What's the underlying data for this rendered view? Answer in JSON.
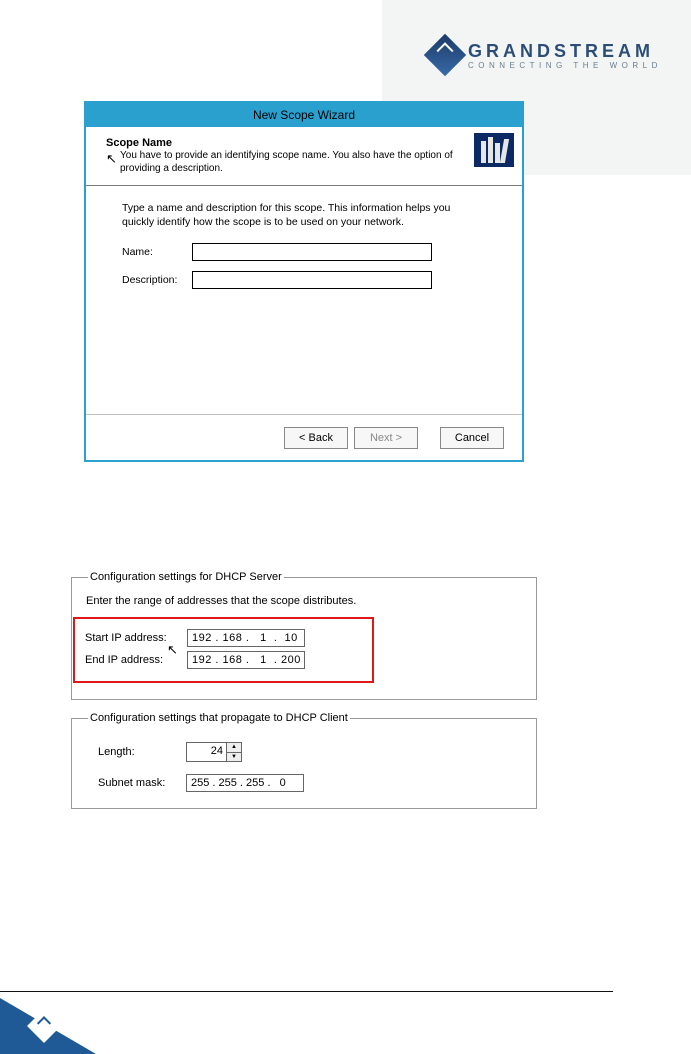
{
  "brand": {
    "name": "GRANDSTREAM",
    "tagline": "CONNECTING THE WORLD"
  },
  "wizard": {
    "title": "New Scope Wizard",
    "heading": "Scope Name",
    "heading_desc": "You have to provide an identifying scope name. You also have the option of providing a description.",
    "body_text": "Type a name and description for this scope. This information helps you quickly identify how the scope is to be used on your network.",
    "name_label": "Name:",
    "name_value": "",
    "desc_label": "Description:",
    "desc_value": "",
    "back_label": "< Back",
    "next_label": "Next >",
    "cancel_label": "Cancel"
  },
  "cfg_server": {
    "legend": "Configuration settings for DHCP Server",
    "range_text": "Enter the range of addresses that the scope distributes.",
    "start_label": "Start IP address:",
    "start_value": "192 . 168 .   1  .  10",
    "end_label": "End IP address:",
    "end_value": "192 . 168 .   1  . 200"
  },
  "cfg_client": {
    "legend": "Configuration settings that propagate to DHCP Client",
    "length_label": "Length:",
    "length_value": "24",
    "mask_label": "Subnet mask:",
    "mask_value": "255 . 255 . 255 .   0"
  }
}
